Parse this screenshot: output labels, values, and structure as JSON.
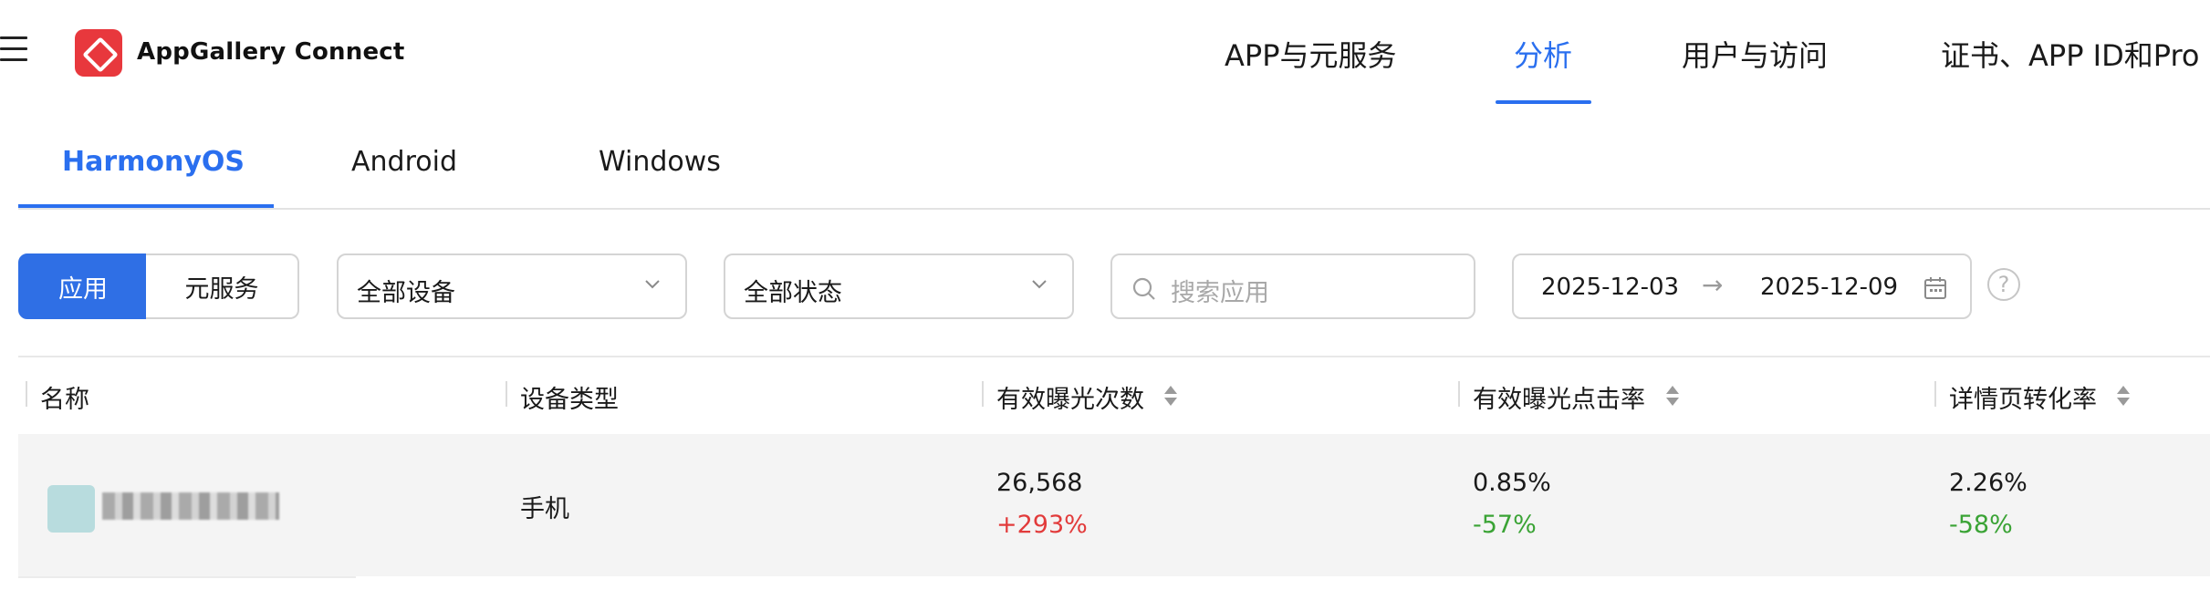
{
  "header": {
    "brand": "AppGallery Connect",
    "nav": [
      {
        "label": "APP与元服务",
        "active": false
      },
      {
        "label": "分析",
        "active": true
      },
      {
        "label": "用户与访问",
        "active": false
      },
      {
        "label": "证书、APP ID和Pro",
        "active": false
      }
    ]
  },
  "platform_tabs": [
    {
      "label": "HarmonyOS",
      "active": true
    },
    {
      "label": "Android",
      "active": false
    },
    {
      "label": "Windows",
      "active": false
    }
  ],
  "filters": {
    "type_toggle": {
      "options": [
        "应用",
        "元服务"
      ],
      "selected": "应用"
    },
    "device_select": {
      "value": "全部设备"
    },
    "status_select": {
      "value": "全部状态"
    },
    "search": {
      "placeholder": "搜索应用",
      "value": ""
    },
    "date_range": {
      "start": "2025-12-03",
      "arrow": "→",
      "end": "2025-12-09"
    },
    "help": "?"
  },
  "table": {
    "columns": [
      "名称",
      "设备类型",
      "有效曝光次数",
      "有效曝光点击率",
      "详情页转化率"
    ],
    "rows": [
      {
        "name": "",
        "device_type": "手机",
        "exposures": "26,568",
        "exposures_change": "+293%",
        "ctr": "0.85%",
        "ctr_change": "-57%",
        "conversion": "2.26%",
        "conversion_change": "-58%"
      }
    ]
  },
  "colors": {
    "accent": "#2a6fef",
    "positive_change": "#e23b3b",
    "negative_change": "#3aa335",
    "brand_logo": "#e8383d"
  }
}
